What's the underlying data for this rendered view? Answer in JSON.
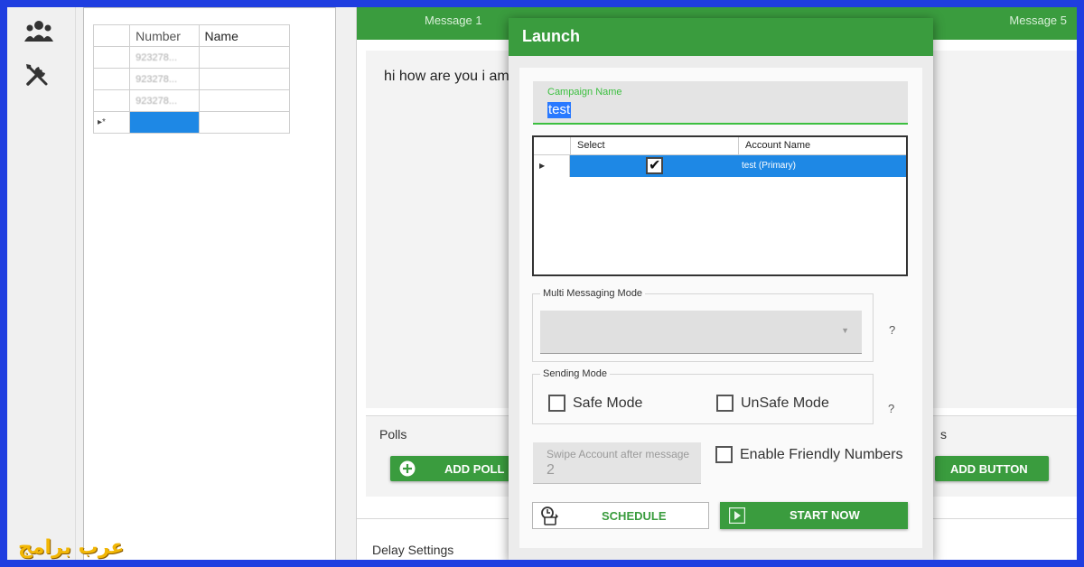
{
  "grid": {
    "headers": [
      "",
      "Number",
      "Name"
    ],
    "rows": [
      {
        "marker": "",
        "number": "923278...",
        "name": ""
      },
      {
        "marker": "",
        "number": "923278...",
        "name": ""
      },
      {
        "marker": "",
        "number": "923278...",
        "name": ""
      },
      {
        "marker": "▸*",
        "number": "",
        "name": ""
      }
    ]
  },
  "tabs": {
    "first": "Message 1",
    "last": "Message 5"
  },
  "message": {
    "text": "hi how are you i am"
  },
  "polls": {
    "label": "Polls",
    "add_poll": "ADD POLL",
    "buttons_label_fragment": "s",
    "add_button": "ADD BUTTON"
  },
  "delay": {
    "label": "Delay Settings"
  },
  "dialog": {
    "title": "Launch",
    "campaign": {
      "label": "Campaign Name",
      "value": "test"
    },
    "accounts": {
      "headers": [
        "Select",
        "Account Name"
      ],
      "rows": [
        {
          "selected": true,
          "name": "test (Primary)"
        }
      ]
    },
    "multi_mode": {
      "label": "Multi Messaging Mode",
      "value": "",
      "help": "?"
    },
    "sending_mode": {
      "label": "Sending Mode",
      "safe": "Safe Mode",
      "unsafe": "UnSafe Mode",
      "safe_checked": false,
      "unsafe_checked": false,
      "help": "?"
    },
    "swipe": {
      "label": "Swipe Account after message",
      "value": "2"
    },
    "friendly": {
      "label": "Enable Friendly Numbers",
      "checked": false
    },
    "schedule_label": "SCHEDULE",
    "start_label": "START NOW"
  },
  "watermark": "عرب برامج",
  "colors": {
    "accent_green": "#3a9c3e",
    "selection_blue": "#1e88e5",
    "field_focus_green": "#3bbf3f",
    "frame_blue": "#1f3ee0"
  },
  "icons": [
    "users-icon",
    "tools-icon",
    "plus-circle-icon",
    "clock-icon",
    "play-icon",
    "checkmark-icon"
  ]
}
